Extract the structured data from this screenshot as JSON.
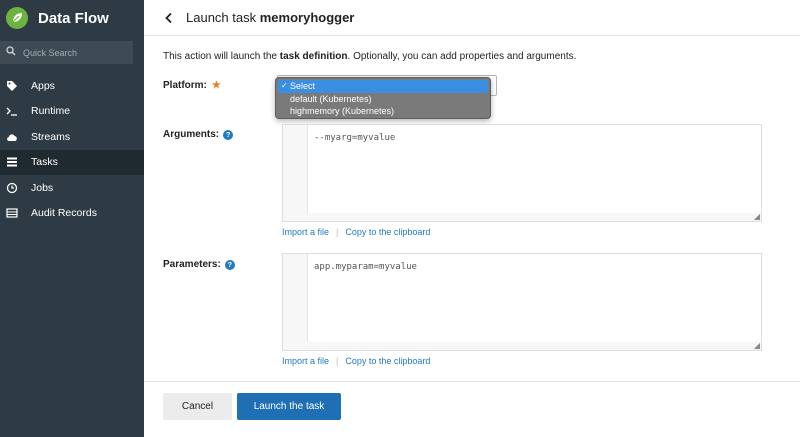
{
  "app": {
    "title": "Data Flow"
  },
  "search": {
    "placeholder": "Quick Search"
  },
  "sidebar": {
    "items": [
      {
        "label": "Apps",
        "icon": "tags-icon",
        "active": false
      },
      {
        "label": "Runtime",
        "icon": "terminal-icon",
        "active": false
      },
      {
        "label": "Streams",
        "icon": "cloud-icon",
        "active": false
      },
      {
        "label": "Tasks",
        "icon": "list-icon",
        "active": true
      },
      {
        "label": "Jobs",
        "icon": "clock-icon",
        "active": false
      },
      {
        "label": "Audit Records",
        "icon": "table-icon",
        "active": false
      }
    ]
  },
  "header": {
    "title_prefix": "Launch task",
    "task_name": "memoryhogger"
  },
  "intro": {
    "before": "This action will launch the ",
    "bold": "task definition",
    "after": ". Optionally, you can add properties and arguments."
  },
  "platform": {
    "label": "Platform:",
    "required_mark": "★",
    "options": [
      "Select",
      "default (Kubernetes)",
      "highmemory (Kubernetes)"
    ],
    "selected": "Select"
  },
  "arguments": {
    "label": "Arguments:",
    "value": "--myarg=myvalue",
    "import_label": "Import a file",
    "copy_label": "Copy to the clipboard"
  },
  "parameters": {
    "label": "Parameters:",
    "value": "app.myparam=myvalue",
    "import_label": "Import a file",
    "copy_label": "Copy to the clipboard"
  },
  "footer": {
    "cancel_label": "Cancel",
    "launch_label": "Launch the task"
  },
  "colors": {
    "sidebar": "#2e3b44",
    "accent": "#1e7bc0",
    "primary_button": "#1e6fb3",
    "brand": "#6db33f"
  }
}
